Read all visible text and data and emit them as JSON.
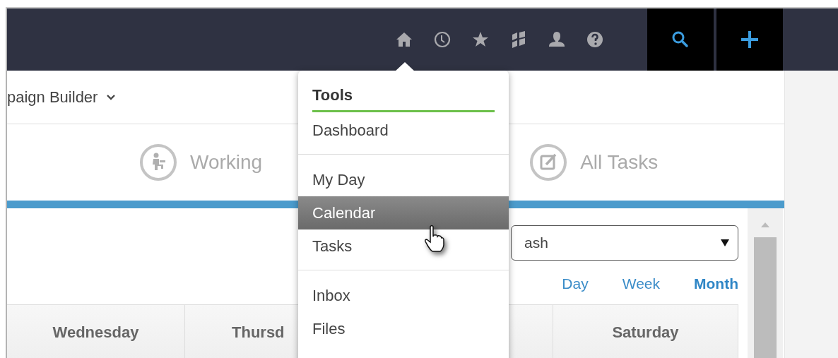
{
  "top_bar": {
    "icons": [
      {
        "kind": "home"
      },
      {
        "kind": "clock"
      },
      {
        "kind": "star"
      },
      {
        "kind": "blocks"
      },
      {
        "kind": "user"
      },
      {
        "kind": "help"
      }
    ],
    "actions": [
      {
        "kind": "search"
      },
      {
        "kind": "add"
      }
    ]
  },
  "breadcrumb": {
    "text": "paign Builder"
  },
  "tabs": [
    {
      "label": "Working",
      "kind": "working"
    },
    {
      "label": "All Tasks",
      "kind": "tasks"
    }
  ],
  "filter_select": {
    "value": "ash"
  },
  "views": [
    {
      "label": "Day",
      "selected": false
    },
    {
      "label": "Week",
      "selected": false
    },
    {
      "label": "Month",
      "selected": true
    }
  ],
  "calendar": {
    "columns": [
      "Wednesday",
      "Thursd",
      "Saturday"
    ]
  },
  "menu": {
    "title": "Tools",
    "groups": [
      [
        {
          "label": "Dashboard",
          "selected": false
        }
      ],
      [
        {
          "label": "My Day",
          "selected": false
        },
        {
          "label": "Calendar",
          "selected": true
        },
        {
          "label": "Tasks",
          "selected": false
        }
      ],
      [
        {
          "label": "Inbox",
          "selected": false
        },
        {
          "label": "Files",
          "selected": false
        }
      ]
    ]
  }
}
